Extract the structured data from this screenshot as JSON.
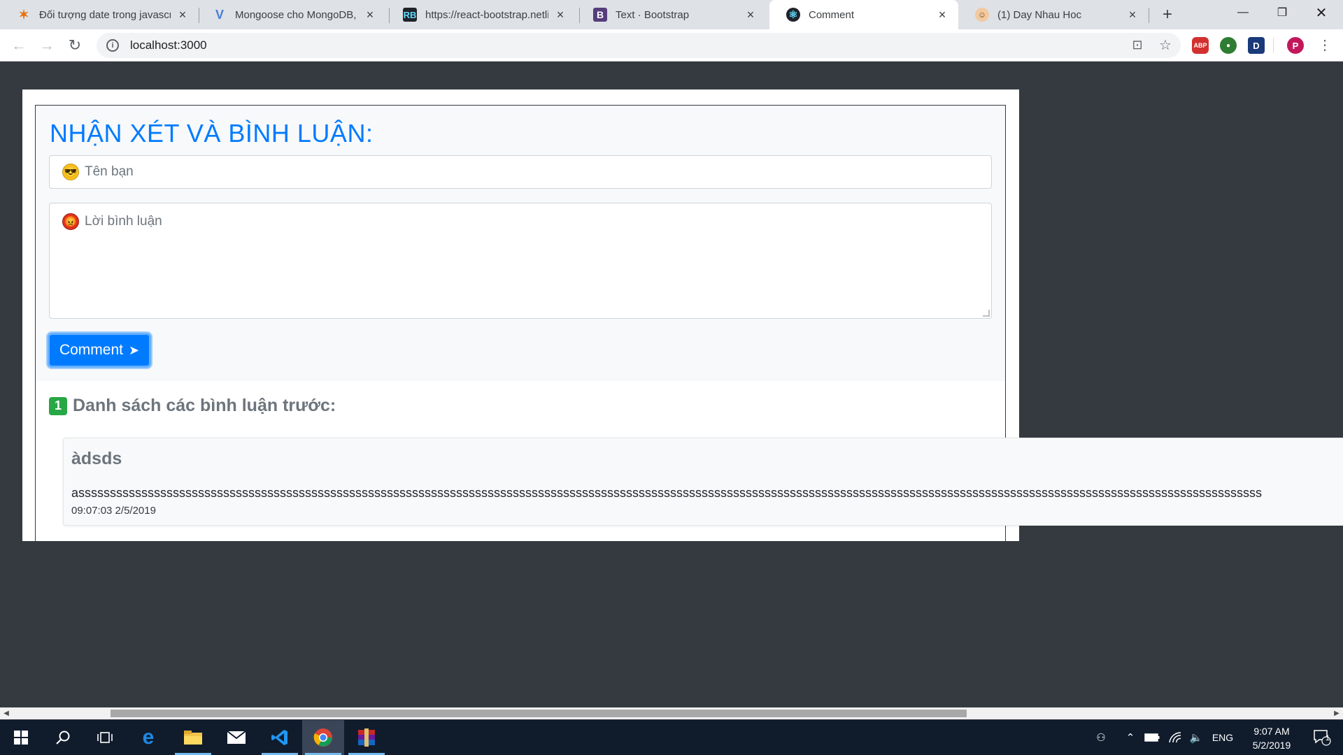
{
  "browser": {
    "tabs": [
      {
        "title": "Đối tượng date trong javascr",
        "favicon": "star-favicon",
        "active": false
      },
      {
        "title": "Mongoose cho MongoDB, N",
        "favicon": "v-favicon",
        "active": false
      },
      {
        "title": "https://react-bootstrap.netlif",
        "favicon": "react-bootstrap-favicon",
        "active": false
      },
      {
        "title": "Text · Bootstrap",
        "favicon": "bootstrap-favicon",
        "favicon_text": "B",
        "active": false
      },
      {
        "title": "Comment",
        "favicon": "react-favicon",
        "active": true
      },
      {
        "title": "(1) Day Nhau Hoc",
        "favicon": "face-favicon",
        "active": false
      }
    ],
    "url": "localhost:3000",
    "profile_initial": "P",
    "ext_abp_label": "ABP",
    "ext_d_label": "D"
  },
  "form": {
    "heading": "NHẬN XÉT VÀ BÌNH LUẬN:",
    "name_placeholder": "Tên bạn",
    "comment_placeholder": "Lời bình luận",
    "submit_label": "Comment"
  },
  "list": {
    "count": "1",
    "title": "Danh sách các bình luận trước:",
    "comments": [
      {
        "name": "àdsds",
        "text": "assssssssssssssssssssssssssssssssssssssssssssssssssssssssssssssssssssssssssssssssssssssssssssssssssssssssssssssssssssssssssssssssssssssssssssssssssssssssssssssssssssssssssssssssssssssssssss",
        "time": "09:07:03 2/5/2019"
      }
    ]
  },
  "taskbar": {
    "language": "ENG",
    "time": "9:07 AM",
    "date": "5/2/2019",
    "notification_count": "1"
  },
  "colors": {
    "primary": "#007bff",
    "success": "#28a745",
    "page_bg": "#343a40",
    "taskbar": "#101c2c"
  }
}
